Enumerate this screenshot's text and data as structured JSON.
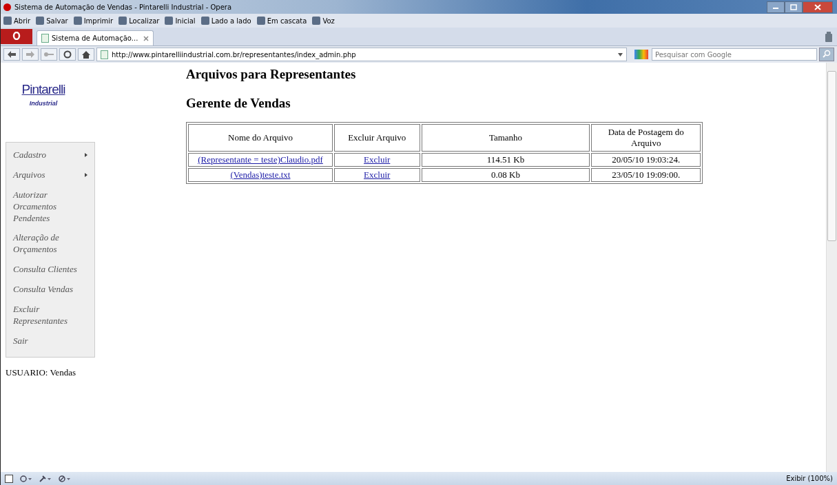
{
  "window": {
    "title": "Sistema de Automação de Vendas - Pintarelli Industrial - Opera"
  },
  "toolbar": [
    "Abrir",
    "Salvar",
    "Imprimir",
    "Localizar",
    "Inicial",
    "Lado a lado",
    "Em cascata",
    "Voz"
  ],
  "tabs": [
    {
      "label": "Sistema de Automação...",
      "selected": true
    }
  ],
  "address": {
    "url": "http://www.pintarelliindustrial.com.br/representantes/index_admin.php"
  },
  "search": {
    "placeholder": "Pesquisar com Google"
  },
  "logo": {
    "name": "Pintarelli",
    "subtitle": "Industrial"
  },
  "sidebar": {
    "items": [
      {
        "label": "Cadastro",
        "submenu": true
      },
      {
        "label": "Arquivos",
        "submenu": true
      },
      {
        "label": "Autorizar Orcamentos Pendentes",
        "submenu": false
      },
      {
        "label": "Alteração de Orçamentos",
        "submenu": false
      },
      {
        "label": "Consulta Clientes",
        "submenu": false
      },
      {
        "label": "Consulta Vendas",
        "submenu": false
      },
      {
        "label": "Excluir Representantes",
        "submenu": false
      },
      {
        "label": "Sair",
        "submenu": false
      }
    ]
  },
  "user": "USUARIO: Vendas",
  "headings": [
    "Arquivos para Representantes",
    "Gerente de Vendas"
  ],
  "table": {
    "columns": [
      "Nome do Arquivo",
      "Excluir Arquivo",
      "Tamanho",
      "Data de Postagem do Arquivo"
    ],
    "rows": [
      {
        "file": "(Representante = teste)Claudio.pdf",
        "action": "Excluir",
        "size": "114.51 Kb",
        "date": "20/05/10 19:03:24."
      },
      {
        "file": "(Vendas)teste.txt",
        "action": "Excluir",
        "size": "0.08 Kb",
        "date": "23/05/10 19:09:00."
      }
    ]
  },
  "status_bar": {
    "zoom": "Exibir (100%)"
  }
}
